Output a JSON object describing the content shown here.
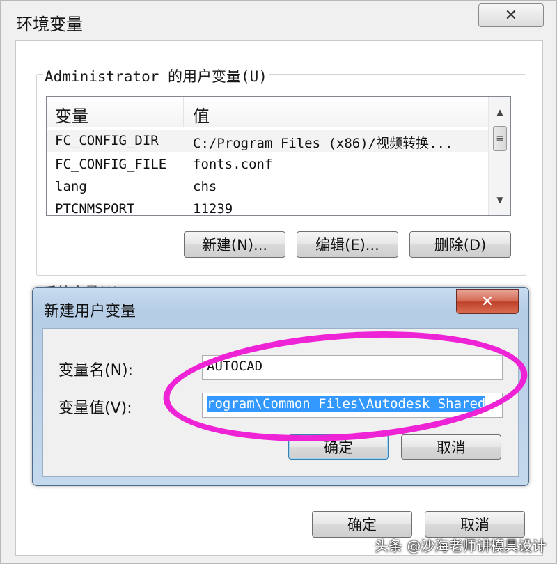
{
  "window": {
    "title": "环境变量",
    "close_glyph": "✕"
  },
  "user_vars": {
    "group_label": "Administrator 的用户变量(U)",
    "columns": [
      "变量",
      "值"
    ],
    "rows": [
      {
        "name": "FC_CONFIG_DIR",
        "value": "C:/Program Files (x86)/视频转换..."
      },
      {
        "name": "FC_CONFIG_FILE",
        "value": "fonts.conf"
      },
      {
        "name": "lang",
        "value": "chs"
      },
      {
        "name": "PTCNMSPORT",
        "value": "11239"
      }
    ],
    "buttons": {
      "new": "新建(N)...",
      "edit": "编辑(E)...",
      "delete": "删除(D)"
    }
  },
  "system_vars": {
    "group_label": "系统变量(S)"
  },
  "new_dialog": {
    "title": "新建用户变量",
    "close_glyph": "✕",
    "name_label": "变量名(N):",
    "name_value": "AUTOCAD",
    "value_label": "变量值(V):",
    "value_value": "rogram\\Common Files\\Autodesk Shared",
    "ok": "确定",
    "cancel": "取消"
  },
  "footer": {
    "ok": "确定",
    "cancel": "取消"
  },
  "watermark": "头条 @沙海老师讲模具设计",
  "colors": {
    "highlight_circle": "#ee23d6",
    "selection": "#3399ff",
    "dialog_frame": "#b5cde6",
    "close_red": "#c0412b"
  },
  "icons": {
    "scroll_up": "▲",
    "scroll_down": "▼",
    "scroll_thumb": "≡"
  }
}
